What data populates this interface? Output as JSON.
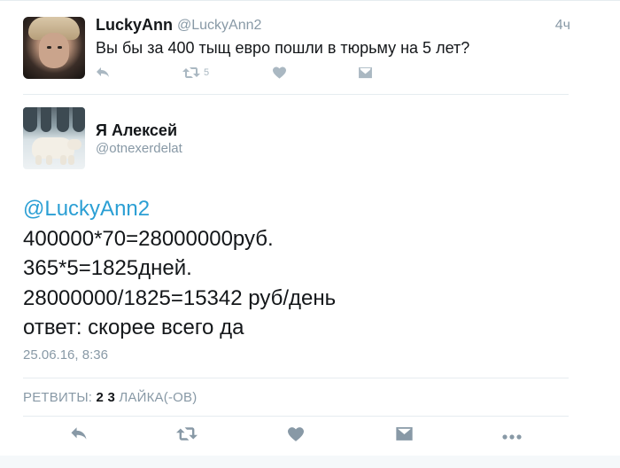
{
  "parent_tweet": {
    "author_name": "LuckyAnn",
    "author_handle": "@LuckyAnn2",
    "time": "4ч",
    "text": "Вы бы за 400 тыщ евро пошли в тюрьму на 5 лет?",
    "retweet_count": "5",
    "actions": [
      "reply-icon",
      "retweet-icon",
      "like-icon",
      "message-icon"
    ]
  },
  "main_tweet": {
    "author_name": "Я Алексей",
    "author_handle": "@otnexerdelat",
    "mention": "@LuckyAnn2",
    "lines": [
      "400000*70=28000000руб.",
      "365*5=1825дней.",
      "28000000/1825=15342 руб/день",
      "ответ: скорее всего да"
    ],
    "date": "25.06.16, 8:36",
    "stats": {
      "retweets_label": "РЕТВИТЫ:",
      "retweets_count": "2",
      "likes_count": "3",
      "likes_label": "ЛАЙКА(-ОВ)"
    },
    "actions": [
      "reply-icon",
      "retweet-icon",
      "like-icon",
      "message-icon",
      "more-icon"
    ]
  },
  "colors": {
    "mention": "#2b9fd4",
    "secondary_text": "#8899a6",
    "icon": "#8899a6",
    "divider": "#e6ecf0"
  }
}
